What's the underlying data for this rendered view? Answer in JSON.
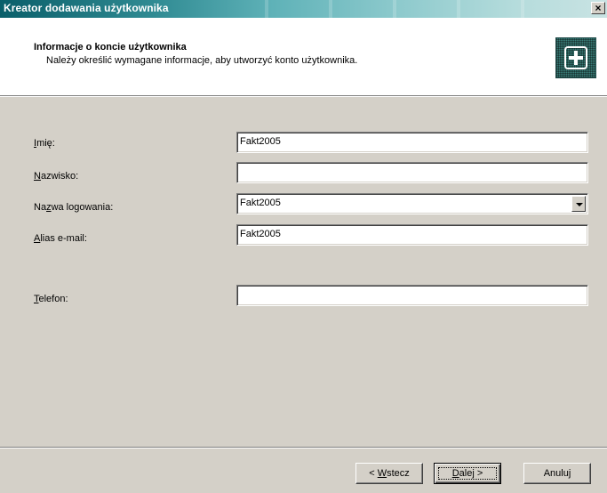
{
  "window": {
    "title": "Kreator dodawania użytkownika",
    "close_label": "×"
  },
  "header": {
    "title": "Informacje o koncie użytkownika",
    "subtitle": "Należy określić wymagane informacje, aby utworzyć konto użytkownika.",
    "icon": "users-wizard-icon"
  },
  "form": {
    "first_name": {
      "label_mnemonic": "I",
      "label_rest": "mię:",
      "value": "Fakt2005"
    },
    "last_name": {
      "label_mnemonic": "N",
      "label_rest": "azwisko:",
      "value": ""
    },
    "login_name": {
      "label_pre": "Na",
      "label_mnemonic": "z",
      "label_rest": "wa logowania:",
      "value": "Fakt2005"
    },
    "email_alias": {
      "label_mnemonic": "A",
      "label_rest": "lias e-mail:",
      "value": "Fakt2005"
    },
    "phone": {
      "label_mnemonic": "T",
      "label_rest": "elefon:",
      "value": ""
    }
  },
  "buttons": {
    "back": {
      "pre": "< ",
      "mnemonic": "W",
      "rest": "stecz"
    },
    "next": {
      "mnemonic": "D",
      "rest": "alej >"
    },
    "cancel": {
      "label": "Anuluj"
    }
  },
  "colors": {
    "dialog_bg": "#d4d0c8",
    "titlebar_start": "#0a5f6a",
    "titlebar_end": "#c9e3e3"
  }
}
